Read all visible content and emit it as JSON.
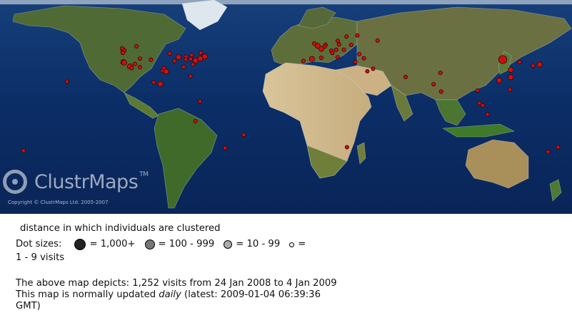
{
  "map": {
    "logo_text": "ClustrMaps",
    "logo_tm": "TM",
    "copyright": "Copyright © ClustrMaps Ltd. 2005-2007",
    "visitor_dots": [
      {
        "lat": 47.5,
        "lon": -122.3,
        "size": "10-99"
      },
      {
        "lat": 45.5,
        "lon": -122.7,
        "size": "1-9"
      },
      {
        "lat": 37.7,
        "lon": -122.4,
        "size": "10-99"
      },
      {
        "lat": 37.3,
        "lon": -121.9,
        "size": "10-99"
      },
      {
        "lat": 34.0,
        "lon": -118.2,
        "size": "10-99"
      },
      {
        "lat": 32.7,
        "lon": -117.1,
        "size": "1-9"
      },
      {
        "lat": 36.1,
        "lon": -115.1,
        "size": "1-9"
      },
      {
        "lat": 40.7,
        "lon": -111.9,
        "size": "1-9"
      },
      {
        "lat": 33.4,
        "lon": -112.0,
        "size": "1-9"
      },
      {
        "lat": 39.7,
        "lon": -105.0,
        "size": "1-9"
      },
      {
        "lat": 44.9,
        "lon": -93.2,
        "size": "1-9"
      },
      {
        "lat": 41.9,
        "lon": -87.6,
        "size": "10-99"
      },
      {
        "lat": 42.3,
        "lon": -83.0,
        "size": "1-9"
      },
      {
        "lat": 39.9,
        "lon": -83.0,
        "size": "1-9"
      },
      {
        "lat": 40.4,
        "lon": -80.0,
        "size": "1-9"
      },
      {
        "lat": 40.7,
        "lon": -74.0,
        "size": "10-99"
      },
      {
        "lat": 42.4,
        "lon": -71.1,
        "size": "10-99"
      },
      {
        "lat": 39.0,
        "lon": -77.0,
        "size": "10-99"
      },
      {
        "lat": 35.8,
        "lon": -78.6,
        "size": "1-9"
      },
      {
        "lat": 33.7,
        "lon": -84.4,
        "size": "1-9"
      },
      {
        "lat": 30.3,
        "lon": -97.7,
        "size": "1-9"
      },
      {
        "lat": 29.8,
        "lon": -95.4,
        "size": "10-99"
      },
      {
        "lat": 32.8,
        "lon": -96.8,
        "size": "1-9"
      },
      {
        "lat": 25.8,
        "lon": -80.2,
        "size": "1-9"
      },
      {
        "lat": 38.6,
        "lon": -90.2,
        "size": "1-9"
      },
      {
        "lat": 43.7,
        "lon": -79.4,
        "size": "1-9"
      },
      {
        "lat": 45.5,
        "lon": -73.6,
        "size": "1-9"
      },
      {
        "lat": 49.3,
        "lon": -123.1,
        "size": "1-9"
      },
      {
        "lat": 51.0,
        "lon": -114.1,
        "size": "1-9"
      },
      {
        "lat": 21.3,
        "lon": -157.8,
        "size": "1-9"
      },
      {
        "lat": 19.4,
        "lon": -99.1,
        "size": "10-99"
      },
      {
        "lat": 20.7,
        "lon": -103.3,
        "size": "1-9"
      },
      {
        "lat": 4.6,
        "lon": -74.1,
        "size": "1-9"
      },
      {
        "lat": -12.0,
        "lon": -77.0,
        "size": "1-9"
      },
      {
        "lat": -23.5,
        "lon": -46.6,
        "size": "1-9"
      },
      {
        "lat": -34.6,
        "lon": -58.4,
        "size": "1-9"
      },
      {
        "lat": 51.5,
        "lon": -0.1,
        "size": "10-99"
      },
      {
        "lat": 53.4,
        "lon": -2.2,
        "size": "1-9"
      },
      {
        "lat": 48.9,
        "lon": 2.3,
        "size": "10-99"
      },
      {
        "lat": 40.4,
        "lon": -3.7,
        "size": "10-99"
      },
      {
        "lat": 41.4,
        "lon": 2.2,
        "size": "1-9"
      },
      {
        "lat": 38.7,
        "lon": -9.1,
        "size": "1-9"
      },
      {
        "lat": 52.4,
        "lon": 4.9,
        "size": "1-9"
      },
      {
        "lat": 50.8,
        "lon": 4.4,
        "size": "1-9"
      },
      {
        "lat": 52.5,
        "lon": 13.4,
        "size": "1-9"
      },
      {
        "lat": 48.1,
        "lon": 11.6,
        "size": "1-9"
      },
      {
        "lat": 47.4,
        "lon": 8.5,
        "size": "1-9"
      },
      {
        "lat": 45.5,
        "lon": 9.2,
        "size": "1-9"
      },
      {
        "lat": 41.9,
        "lon": 12.5,
        "size": "1-9"
      },
      {
        "lat": 48.2,
        "lon": 16.4,
        "size": "1-9"
      },
      {
        "lat": 52.2,
        "lon": 21.0,
        "size": "1-9"
      },
      {
        "lat": 59.3,
        "lon": 18.1,
        "size": "1-9"
      },
      {
        "lat": 60.2,
        "lon": 24.9,
        "size": "1-9"
      },
      {
        "lat": 55.7,
        "lon": 12.6,
        "size": "1-9"
      },
      {
        "lat": 55.8,
        "lon": 37.6,
        "size": "1-9"
      },
      {
        "lat": 44.4,
        "lon": 26.1,
        "size": "1-9"
      },
      {
        "lat": 37.9,
        "lon": 23.7,
        "size": "1-9"
      },
      {
        "lat": 41.0,
        "lon": 29.0,
        "size": "1-9"
      },
      {
        "lat": 32.1,
        "lon": 34.8,
        "size": "1-9"
      },
      {
        "lat": 25.2,
        "lon": 55.3,
        "size": "1-9"
      },
      {
        "lat": 19.1,
        "lon": 72.9,
        "size": "1-9"
      },
      {
        "lat": 28.6,
        "lon": 77.2,
        "size": "1-9"
      },
      {
        "lat": 12.9,
        "lon": 77.6,
        "size": "1-9"
      },
      {
        "lat": 13.8,
        "lon": 100.5,
        "size": "1-9"
      },
      {
        "lat": 1.3,
        "lon": 103.8,
        "size": "1-9"
      },
      {
        "lat": 3.1,
        "lon": 101.7,
        "size": "1-9"
      },
      {
        "lat": 22.3,
        "lon": 114.2,
        "size": "10-99"
      },
      {
        "lat": 25.0,
        "lon": 121.5,
        "size": "10-99"
      },
      {
        "lat": 31.2,
        "lon": 121.5,
        "size": "10-99"
      },
      {
        "lat": 39.9,
        "lon": 116.4,
        "size": "100-999"
      },
      {
        "lat": 37.6,
        "lon": 127.0,
        "size": "1-9"
      },
      {
        "lat": 35.7,
        "lon": 139.7,
        "size": "10-99"
      },
      {
        "lat": 34.7,
        "lon": 135.5,
        "size": "1-9"
      },
      {
        "lat": 14.6,
        "lon": 121.0,
        "size": "1-9"
      },
      {
        "lat": -6.2,
        "lon": 106.8,
        "size": "1-9"
      },
      {
        "lat": -33.9,
        "lon": 151.2,
        "size": "1-9"
      },
      {
        "lat": -37.8,
        "lon": 145.0,
        "size": "1-9"
      },
      {
        "lat": -36.8,
        "lon": 174.8,
        "size": "1-9"
      },
      {
        "lat": -33.9,
        "lon": 18.4,
        "size": "1-9"
      },
      {
        "lat": 30.0,
        "lon": 31.2,
        "size": "1-9"
      }
    ]
  },
  "legend": {
    "cluster_text": "distance in which individuals are clustered",
    "dot_sizes_label": "Dot sizes:",
    "items": [
      {
        "label": "= 1,000+"
      },
      {
        "label": "= 100 - 999"
      },
      {
        "label": "= 10 - 99"
      },
      {
        "label": "="
      }
    ],
    "visits_tail": "1 - 9 visits"
  },
  "stats": {
    "depicts_line": "The above map depicts: 1,252 visits from 24 Jan 2008 to 4 Jan 2009",
    "updated_prefix": "This map is normally updated ",
    "updated_em": "daily",
    "updated_suffix": " (latest: 2009-01-04 06:39:36 GMT)"
  },
  "colors": {
    "ocean": "#0a2a5e",
    "land": "#8a7a3a",
    "dot": "#d01010"
  }
}
